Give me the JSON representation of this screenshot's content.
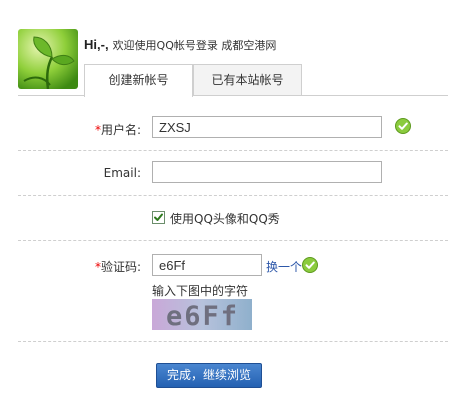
{
  "header": {
    "hi": "Hi,-,",
    "welcome": "欢迎使用QQ帐号登录 成都空港网"
  },
  "tabs": [
    {
      "label": "创建新帐号",
      "active": true
    },
    {
      "label": "已有本站帐号",
      "active": false
    }
  ],
  "form": {
    "required_mark": "*",
    "username": {
      "label": "用户名:",
      "value": "ZXSJ",
      "valid": true
    },
    "email": {
      "label": "Email:",
      "value": ""
    },
    "use_qq_avatar": {
      "label": "使用QQ头像和QQ秀",
      "checked": true
    },
    "captcha": {
      "label": "验证码:",
      "value": "e6Ff",
      "refresh_label": "换一个",
      "hint": "输入下图中的字符",
      "image_text": "e6Ff",
      "valid": true
    },
    "submit_label": "完成，继续浏览"
  },
  "colors": {
    "accent": "#2461b2",
    "required": "#ee0000",
    "valid_green": "#7cc43a"
  },
  "icons": {
    "avatar": "green-sprout-avatar",
    "valid": "green-check-circle-icon",
    "checkbox": "checkbox-checked-icon"
  }
}
